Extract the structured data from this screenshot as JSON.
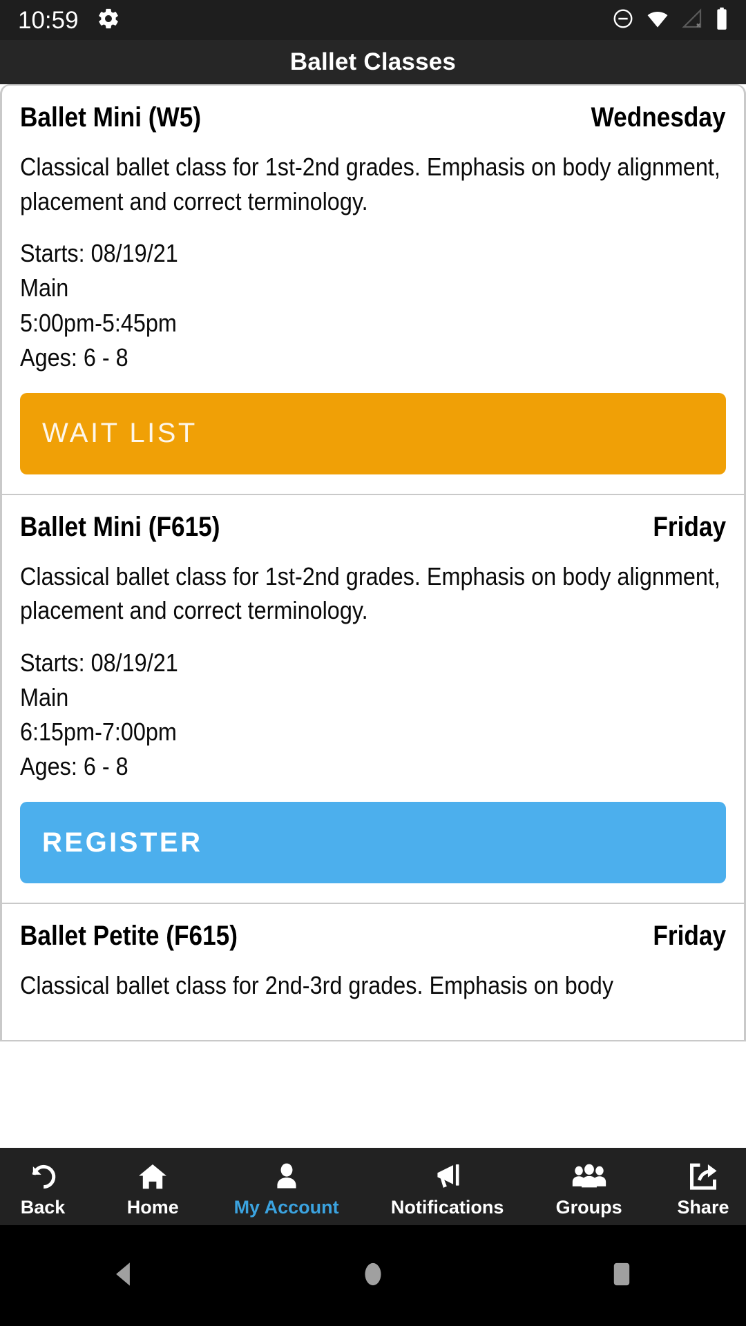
{
  "status_bar": {
    "time": "10:59",
    "icons_left": [
      "gear-icon"
    ],
    "icons_right": [
      "do-not-disturb-icon",
      "wifi-icon",
      "cellular-off-icon",
      "battery-icon"
    ]
  },
  "header": {
    "title": "Ballet Classes"
  },
  "classes": [
    {
      "name": "Ballet Mini (W5)",
      "day": "Wednesday",
      "description": "Classical ballet class for 1st-2nd grades. Emphasis on body alignment, placement and correct terminology.",
      "starts": "Starts: 08/19/21",
      "location": "Main",
      "time": "5:00pm-5:45pm",
      "ages": "Ages: 6 - 8",
      "action_label": "WAIT LIST",
      "action_type": "waitlist",
      "action_color": "#F0A006"
    },
    {
      "name": "Ballet Mini (F615)",
      "day": "Friday",
      "description": "Classical ballet class for 1st-2nd grades. Emphasis on body alignment, placement and correct terminology.",
      "starts": "Starts: 08/19/21",
      "location": "Main",
      "time": "6:15pm-7:00pm",
      "ages": "Ages: 6 - 8",
      "action_label": "REGISTER",
      "action_type": "register",
      "action_color": "#4CAFED"
    },
    {
      "name": "Ballet Petite (F615)",
      "day": "Friday",
      "description": "Classical ballet class for 2nd-3rd grades. Emphasis on body",
      "starts": "",
      "location": "",
      "time": "",
      "ages": "",
      "action_label": "",
      "action_type": "",
      "action_color": ""
    }
  ],
  "bottom_nav": {
    "active": "My Account",
    "active_color": "#3BA3E0",
    "items": [
      {
        "label": "Back",
        "icon": "undo-arrow-icon"
      },
      {
        "label": "Home",
        "icon": "home-icon"
      },
      {
        "label": "My Account",
        "icon": "person-icon"
      },
      {
        "label": "Notifications",
        "icon": "megaphone-icon"
      },
      {
        "label": "Groups",
        "icon": "people-group-icon"
      },
      {
        "label": "Share",
        "icon": "share-icon"
      }
    ]
  },
  "system_nav": {
    "items": [
      {
        "name": "back",
        "icon": "triangle-left-icon"
      },
      {
        "name": "home",
        "icon": "circle-icon"
      },
      {
        "name": "recents",
        "icon": "square-icon"
      }
    ]
  }
}
